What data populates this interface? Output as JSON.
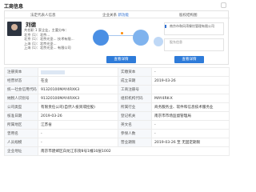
{
  "title": "工商信息",
  "watermark": "",
  "cards": {
    "rep_header": "法定代表人信息",
    "graph_header_left": "企业关系",
    "graph_header_highlight": "新功能",
    "equity_header": "股权结构图",
    "graph_button": "查看详情",
    "equity_button": "查看详情"
  },
  "rep": {
    "name": "刘德",
    "lines": [
      {
        "k": "",
        "v": "共任职 1 家企业，主要分布："
      },
      {
        "k": "北京 (1)",
        "v": "：北京..."
      },
      {
        "k": "北京 (1)",
        "v": "：北京光圣... 技术有限..."
      },
      {
        "k": "上海 (1)",
        "v": "：北京光圣..."
      },
      {
        "k": "上海 (1)",
        "v": "：北京光圣... 有限公司"
      }
    ]
  },
  "equity": {
    "box1": "南京市和风湾餐饮管理有限公司",
    "box2": "股东信息"
  },
  "table": [
    {
      "k1": "注册资本",
      "v1": "",
      "k2": "实缴资本",
      "v2": "-"
    },
    {
      "k1": "经营状态",
      "v1": "在业",
      "k2": "成立日期",
      "v2": "2019-03-26"
    },
    {
      "k1": "统一社会信用代码",
      "v1": "91320100MAY4RXK3",
      "k2": "工商注册号",
      "v2": ""
    },
    {
      "k1": "纳税人识别号",
      "v1": "91320100MAY4RXK3",
      "k2": "组织机构代码",
      "v2": "MAY4RK-X"
    },
    {
      "k1": "公司类型",
      "v1": "有限责任公司(自然人投资或控股)",
      "k2": "所属行业",
      "v2": "商务服务业、软件和信息技术服务业"
    },
    {
      "k1": "核准日期",
      "v1": "2019-03-26",
      "k2": "登记机关",
      "v2": "南京市市场监督管理局"
    },
    {
      "k1": "所属地区",
      "v1": "江苏省",
      "k2": "英文名",
      "v2": "-"
    },
    {
      "k1": "曾用名",
      "v1": "-",
      "k2": "参保人数",
      "v2": "-"
    },
    {
      "k1": "人员规模",
      "v1": "-",
      "k2": "营业期限",
      "v2": "2019-03-26 至 无固定期限"
    },
    {
      "k1": "企业地址",
      "v1": "南京市建邺区白龙江东街8号1幢10层1002",
      "k2": "",
      "v2": ""
    }
  ],
  "colors": {
    "accent": "#2e7bd9",
    "header_bg": "#f6f8fb",
    "border": "#ececec"
  }
}
